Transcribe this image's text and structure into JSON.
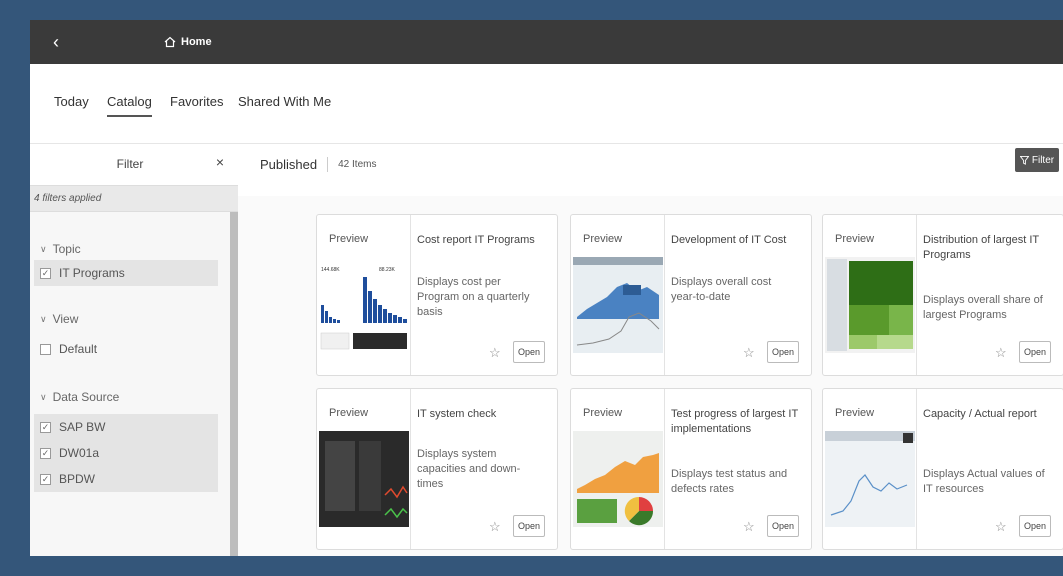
{
  "shell": {
    "home_label": "Home"
  },
  "tabs": [
    {
      "label": "Today"
    },
    {
      "label": "Catalog"
    },
    {
      "label": "Favorites"
    },
    {
      "label": "Shared With Me"
    }
  ],
  "filter_panel": {
    "title": "Filter",
    "applied": "4 filters applied",
    "groups": [
      {
        "label": "Topic",
        "options": [
          {
            "label": "IT Programs",
            "checked": true
          }
        ]
      },
      {
        "label": "View",
        "options": [
          {
            "label": "Default",
            "checked": false
          }
        ]
      },
      {
        "label": "Data Source",
        "options": [
          {
            "label": "SAP BW",
            "checked": true
          },
          {
            "label": "DW01a",
            "checked": true
          },
          {
            "label": "BPDW",
            "checked": true
          }
        ]
      }
    ]
  },
  "content": {
    "section": "Published",
    "count": "42 Items",
    "filter_button": "Filter"
  },
  "cards": [
    {
      "preview": "Preview",
      "title": "Cost report IT Programs",
      "desc": "Displays cost per Program on a quarterly basis",
      "open": "Open",
      "thumb_values": [
        "144.68K",
        "88.23K"
      ]
    },
    {
      "preview": "Preview",
      "title": "Development of IT Cost",
      "desc": "Displays overall cost year-to-date",
      "open": "Open"
    },
    {
      "preview": "Preview",
      "title": "Distribution of largest IT Programs",
      "desc": "Displays overall share of largest Programs",
      "open": "Open"
    },
    {
      "preview": "Preview",
      "title": "IT system check",
      "desc": "Displays system capacities and down-times",
      "open": "Open"
    },
    {
      "preview": "Preview",
      "title": "Test progress of largest IT implementations",
      "desc": "Displays test status and defects rates",
      "open": "Open"
    },
    {
      "preview": "Preview",
      "title": "Capacity / Actual report",
      "desc": "Displays Actual values of IT resources",
      "open": "Open"
    }
  ]
}
